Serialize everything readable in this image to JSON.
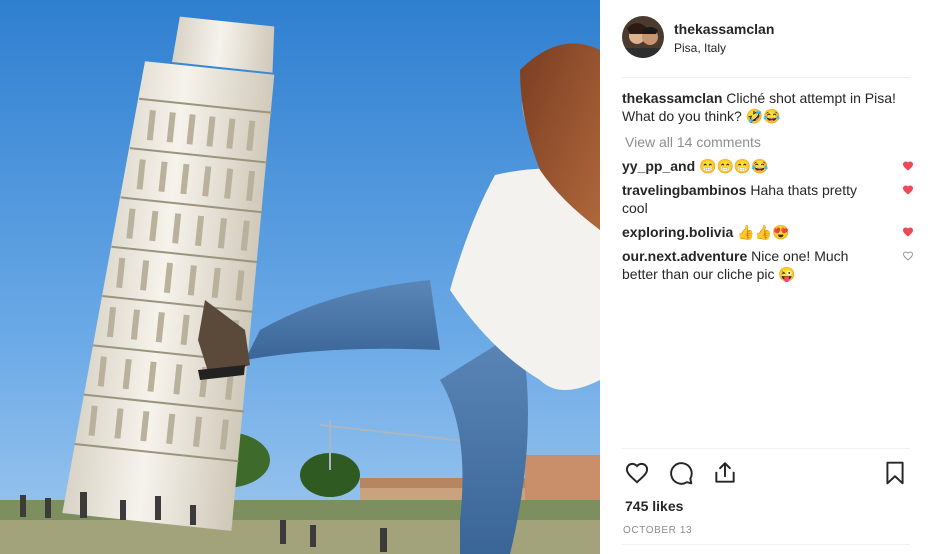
{
  "post": {
    "username": "thekassamclan",
    "location": "Pisa, Italy",
    "caption_text": "Cliché shot attempt in Pisa! What do you think? 🤣😂",
    "view_all_comments": "View all 14 comments"
  },
  "comments": [
    {
      "user": "yy_pp_and",
      "text": "😁😁😁😂",
      "liked": true
    },
    {
      "user": "travelingbambinos",
      "text": "Haha thats pretty cool",
      "liked": true
    },
    {
      "user": "exploring.bolivia",
      "text": "👍👍😍",
      "liked": true
    },
    {
      "user": "our.next.adventure",
      "text": "Nice one! Much better than our cliche pic 😜",
      "liked": false
    }
  ],
  "engagement": {
    "likes": "745 likes",
    "date": "OCTOBER 13"
  },
  "colors": {
    "liked_heart": "#ed4956",
    "unliked_heart": "#999999",
    "secondary_text": "#8e8e8e"
  },
  "icons": [
    "heart-icon",
    "comment-icon",
    "share-icon",
    "bookmark-icon"
  ]
}
